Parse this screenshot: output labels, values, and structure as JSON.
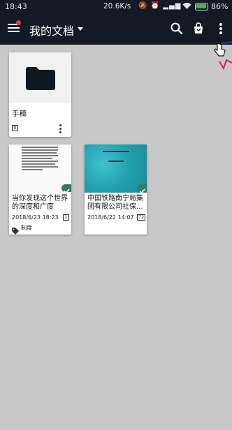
{
  "status_bar": {
    "time": "18:43",
    "network_speed": "20.6K/s",
    "battery_percent": "86%",
    "battery_level": 0.86
  },
  "app_bar": {
    "title": "我的文档",
    "icons": [
      "menu-icon",
      "search-icon",
      "shopping-bag-icon",
      "more-vert-icon"
    ]
  },
  "folder": {
    "name": "手稿",
    "count": "0"
  },
  "documents": [
    {
      "title": "当你发现这个世界的深度和广度",
      "date": "2018/6/23 18:23",
      "pages": "1",
      "tag": "制度",
      "thumbnail": "text-page"
    },
    {
      "title": "中国铁路南宁局集团有限公司社保...",
      "date": "2018/6/22 14:07",
      "pages": "72",
      "thumbnail": "teal-cover"
    }
  ],
  "colors": {
    "app_bar": "#141a24",
    "background": "#c8c8c8",
    "sync_badge": "#2e7d6b",
    "notification_dot": "#e53935"
  }
}
